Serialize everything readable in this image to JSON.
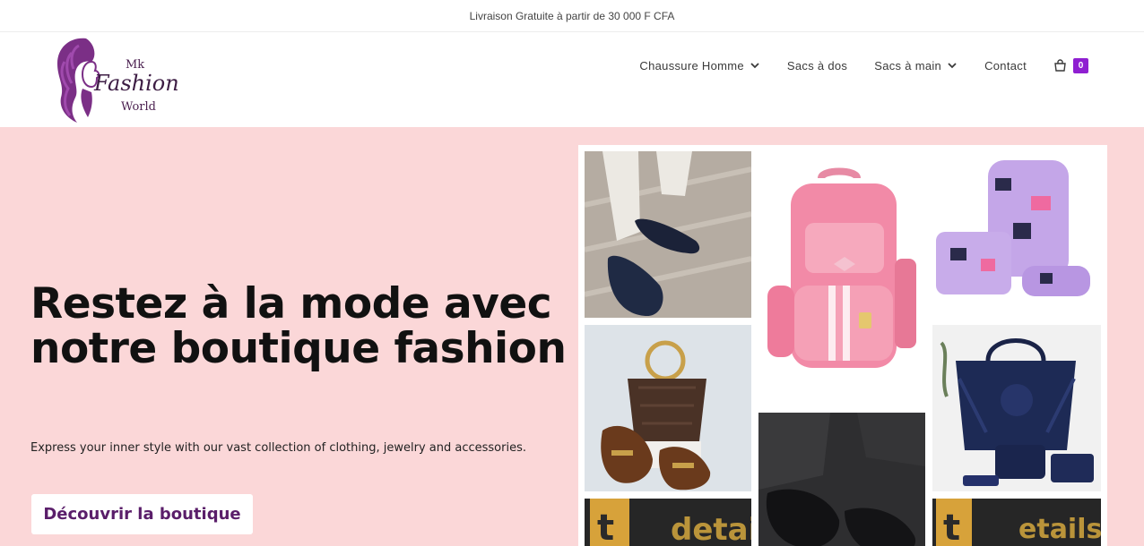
{
  "topbar": {
    "text": "Livraison Gratuite à partir de 30 000 F CFA"
  },
  "logo": {
    "line1": "Mk",
    "line2": "Fashion",
    "line3": "World"
  },
  "nav": {
    "items": [
      {
        "label": "Chaussure Homme",
        "has_dropdown": true
      },
      {
        "label": "Sacs à dos",
        "has_dropdown": false
      },
      {
        "label": "Sacs à main",
        "has_dropdown": true
      },
      {
        "label": "Contact",
        "has_dropdown": false
      }
    ],
    "cart": {
      "icon": "shopping-bag-icon",
      "count": "0"
    }
  },
  "hero": {
    "title": "Restez à la mode avec notre boutique fashion",
    "subtitle": "Express your inner style with our vast collection of clothing, jewelry and accessories.",
    "button": "Découvrir la boutique",
    "background": "#fbd7d8"
  },
  "collage": {
    "t7_text": "t",
    "t7_text2": "detai",
    "t8_text": "t",
    "t8_text2": "etails"
  },
  "colors": {
    "accent": "#8f1fd1",
    "brand": "#5a1e6a",
    "hero_bg": "#fbd7d8"
  }
}
